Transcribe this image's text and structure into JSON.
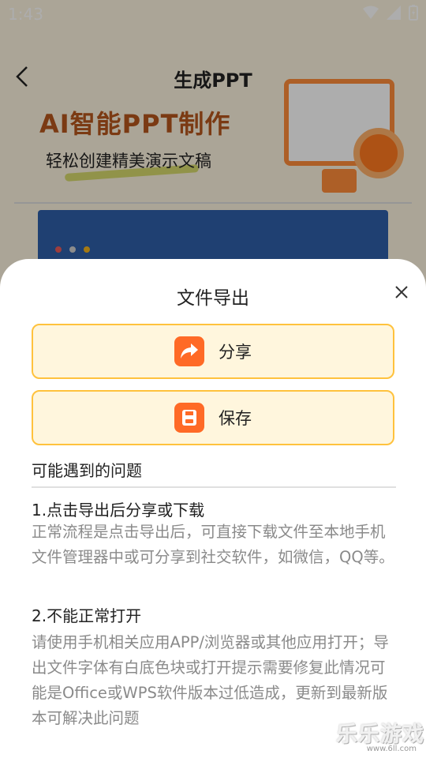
{
  "status_bar": {
    "time": "1:43"
  },
  "nav": {
    "title": "生成PPT"
  },
  "banner": {
    "headline": "AI智能PPT制作",
    "subtitle": "轻松创建精美演示文稿"
  },
  "preview": {
    "dot_colors": [
      "#e85a5a",
      "#cfcfcf",
      "#f2b31d"
    ]
  },
  "sheet": {
    "title": "文件导出",
    "share_label": "分享",
    "save_label": "保存",
    "faq_heading": "可能遇到的问题",
    "faq": [
      {
        "question": "1.点击导出后分享或下载",
        "answer": "正常流程是点击导出后，可直接下载文件至本地手机文件管理器中或可分享到社交软件，如微信，QQ等。"
      },
      {
        "question": "2.不能正常打开",
        "answer": "请使用手机相关应用APP/浏览器或其他应用打开；导出文件字体有白底色块或打开提示需要修复此情况可能是Office或WPS软件版本过低造成，更新到最新版本可解决此问题"
      }
    ]
  },
  "watermark": {
    "text": "乐乐游戏",
    "url": "www.6ll.com"
  },
  "colors": {
    "accent": "#ff6a26",
    "button_bg": "#fff6dd",
    "button_border": "#ffc23d"
  }
}
